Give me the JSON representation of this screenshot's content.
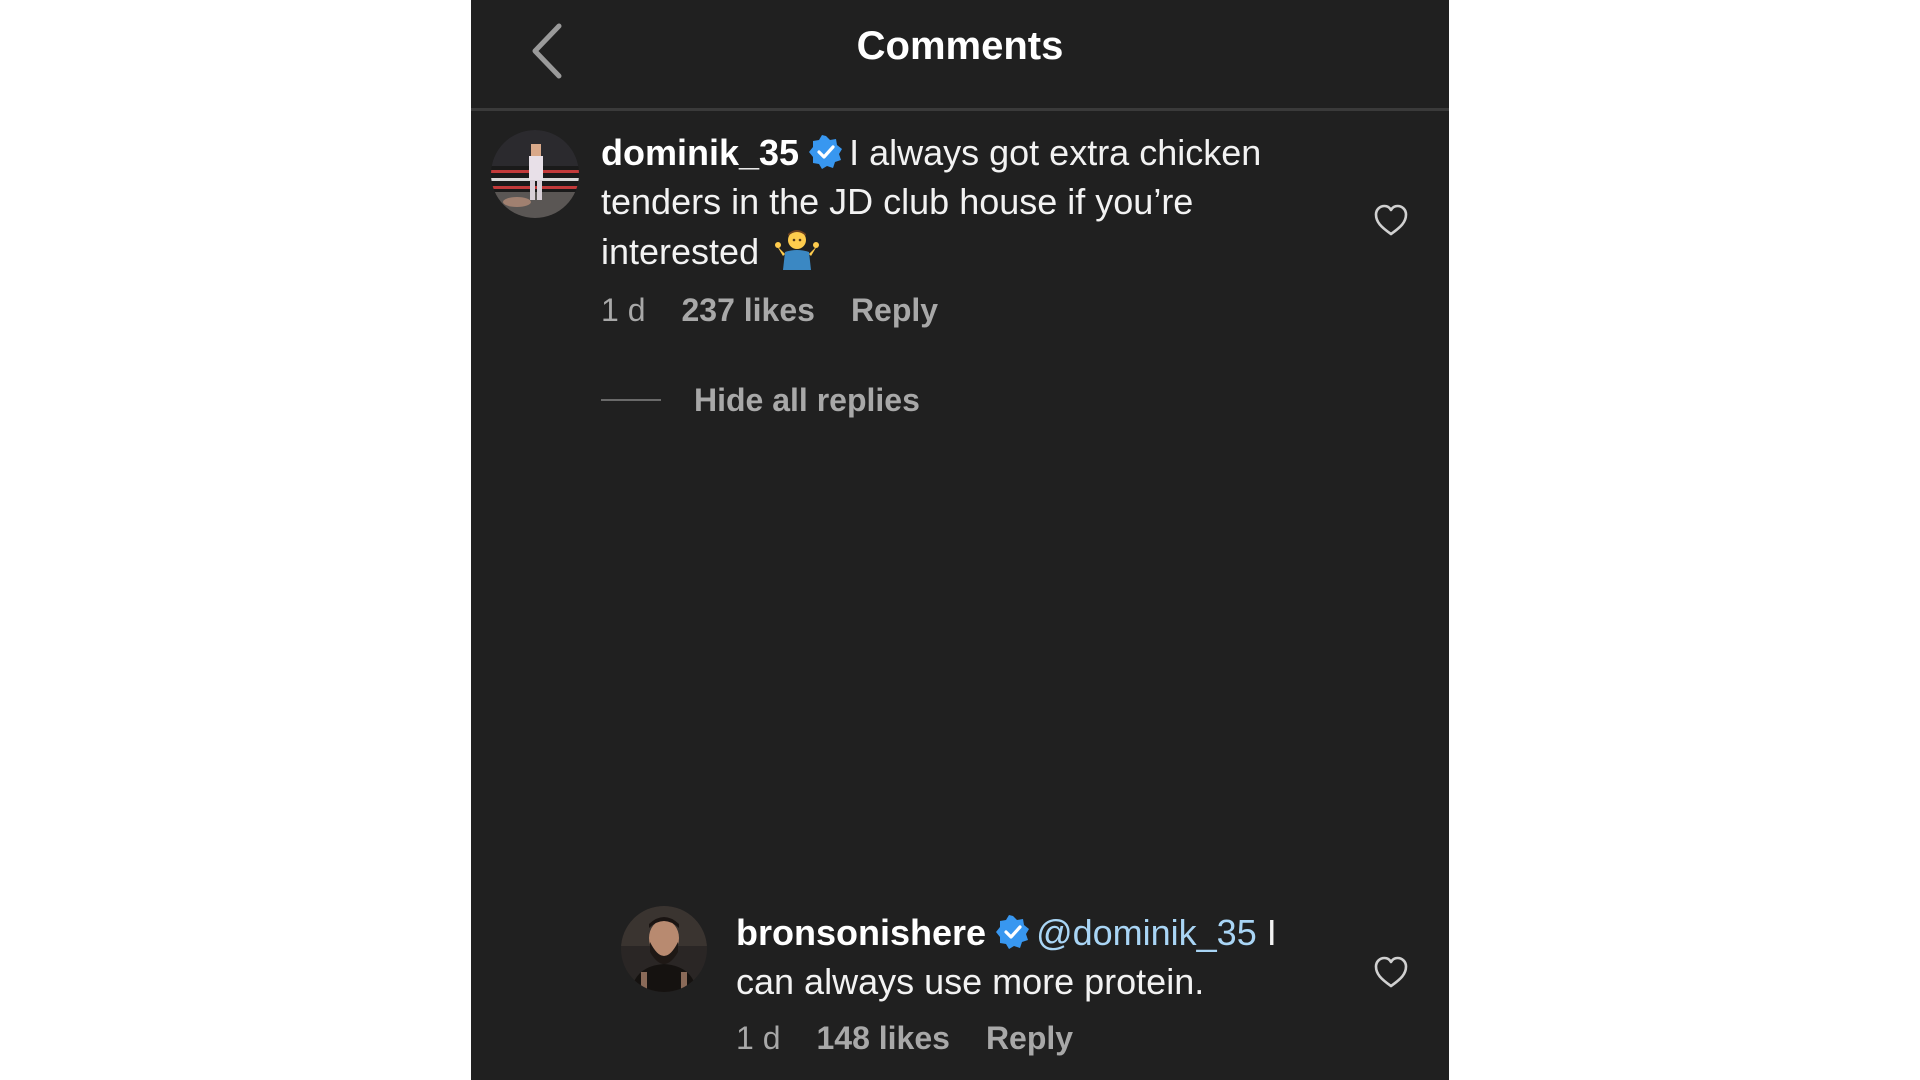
{
  "header": {
    "title": "Comments"
  },
  "comments": [
    {
      "username": "dominik_35",
      "text": "I always got extra chicken tenders in the JD club house if you’re interested",
      "emoji": "🤷‍♂️",
      "time": "1 d",
      "likes": "237 likes",
      "reply": "Reply"
    }
  ],
  "hide_replies": "Hide all replies",
  "replies": [
    {
      "username": "bronsonishere",
      "mention": "@dominik_35",
      "text": "I can always use more protein.",
      "time": "1 d",
      "likes": "148 likes",
      "reply": "Reply"
    }
  ],
  "colors": {
    "background": "#202020",
    "verified": "#3897f0",
    "mention": "#a9d5f5",
    "muted": "#a8a8a8"
  },
  "icons": {
    "back": "chevron-left-icon",
    "verified": "verified-badge-icon",
    "like": "heart-outline-icon"
  }
}
